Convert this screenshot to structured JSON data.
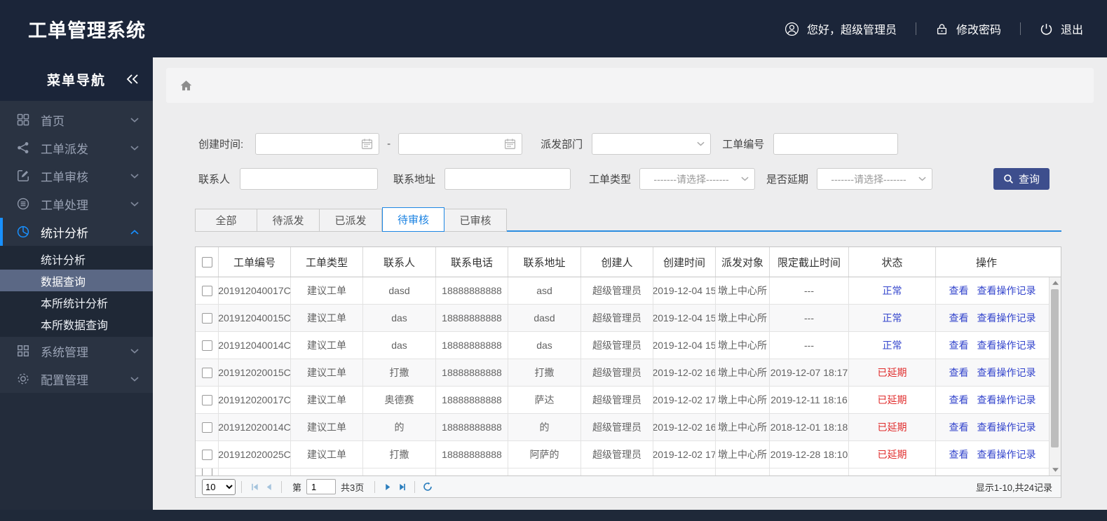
{
  "palette": {
    "accent_blue": "#1890ff",
    "link_blue": "#3344cc",
    "danger_red": "#e02b2b",
    "button_bg": "#3d4e8d",
    "header_bg": "#1b2539",
    "sidebar_bg": "#232c3b",
    "menu_bg": "#2a3342",
    "submenu_bg": "#1f2836",
    "submenu_active_bg": "#5b6885"
  },
  "header": {
    "title": "工单管理系统",
    "greeting": "您好，超级管理员",
    "change_password": "修改密码",
    "logout": "退出"
  },
  "sidebar": {
    "title": "菜单导航",
    "items": [
      {
        "id": "home",
        "label": "首页",
        "icon": "grid-icon"
      },
      {
        "id": "dispatch",
        "label": "工单派发",
        "icon": "share-icon"
      },
      {
        "id": "review",
        "label": "工单审核",
        "icon": "edit-icon"
      },
      {
        "id": "process",
        "label": "工单处理",
        "icon": "process-icon"
      },
      {
        "id": "stats",
        "label": "统计分析",
        "icon": "pie-icon",
        "active": true,
        "children": [
          {
            "id": "stats-analysis",
            "label": "统计分析"
          },
          {
            "id": "data-query",
            "label": "数据查询",
            "active": true
          },
          {
            "id": "branch-stats",
            "label": "本所统计分析"
          },
          {
            "id": "branch-data-query",
            "label": "本所数据查询"
          }
        ]
      },
      {
        "id": "system",
        "label": "系统管理",
        "icon": "modules-icon"
      },
      {
        "id": "config",
        "label": "配置管理",
        "icon": "gear-icon"
      }
    ]
  },
  "filters": {
    "create_time_label": "创建时间:",
    "range_separator": "-",
    "dispatch_dept_label": "派发部门",
    "order_no_label": "工单编号",
    "contact_label": "联系人",
    "address_label": "联系地址",
    "order_type_label": "工单类型",
    "delay_label": "是否延期",
    "select_placeholder": "-------请选择-------",
    "search_button": "查询"
  },
  "tabs": [
    {
      "id": "all",
      "label": "全部"
    },
    {
      "id": "pending-dispatch",
      "label": "待派发"
    },
    {
      "id": "dispatched",
      "label": "已派发"
    },
    {
      "id": "pending-review",
      "label": "待审核",
      "active": true
    },
    {
      "id": "reviewed",
      "label": "已审核"
    }
  ],
  "table": {
    "columns": [
      "工单编号",
      "工单类型",
      "联系人",
      "联系电话",
      "联系地址",
      "创建人",
      "创建时间",
      "派发对象",
      "限定截止时间",
      "状态",
      "操作"
    ],
    "action_labels": [
      "查看",
      "查看操作记录"
    ],
    "rows": [
      {
        "order_no": "201912040017C",
        "order_type": "建议工单",
        "contact": "dasd",
        "phone": "18888888888",
        "address": "asd",
        "creator": "超级管理员",
        "created_time": "2019-12-04 15",
        "dispatch_target": "墩上中心所",
        "deadline": "---",
        "status": "正常",
        "status_type": "normal"
      },
      {
        "order_no": "201912040015C",
        "order_type": "建议工单",
        "contact": "das",
        "phone": "18888888888",
        "address": "dasd",
        "creator": "超级管理员",
        "created_time": "2019-12-04 15",
        "dispatch_target": "墩上中心所",
        "deadline": "---",
        "status": "正常",
        "status_type": "normal"
      },
      {
        "order_no": "201912040014C",
        "order_type": "建议工单",
        "contact": "das",
        "phone": "18888888888",
        "address": "das",
        "creator": "超级管理员",
        "created_time": "2019-12-04 15",
        "dispatch_target": "墩上中心所",
        "deadline": "---",
        "status": "正常",
        "status_type": "normal"
      },
      {
        "order_no": "201912020015C",
        "order_type": "建议工单",
        "contact": "打撒",
        "phone": "18888888888",
        "address": "打撒",
        "creator": "超级管理员",
        "created_time": "2019-12-02 16",
        "dispatch_target": "墩上中心所",
        "deadline": "2019-12-07 18:17",
        "status": "已延期",
        "status_type": "delayed"
      },
      {
        "order_no": "201912020017C",
        "order_type": "建议工单",
        "contact": "奥德赛",
        "phone": "18888888888",
        "address": "萨达",
        "creator": "超级管理员",
        "created_time": "2019-12-02 17",
        "dispatch_target": "墩上中心所",
        "deadline": "2019-12-11 18:16",
        "status": "已延期",
        "status_type": "delayed"
      },
      {
        "order_no": "201912020014C",
        "order_type": "建议工单",
        "contact": "的",
        "phone": "18888888888",
        "address": "的",
        "creator": "超级管理员",
        "created_time": "2019-12-02 16",
        "dispatch_target": "墩上中心所",
        "deadline": "2018-12-01 18:18",
        "status": "已延期",
        "status_type": "delayed"
      },
      {
        "order_no": "201912020025C",
        "order_type": "建议工单",
        "contact": "打撒",
        "phone": "18888888888",
        "address": "阿萨的",
        "creator": "超级管理员",
        "created_time": "2019-12-02 17",
        "dispatch_target": "墩上中心所",
        "deadline": "2019-12-28 18:10",
        "status": "已延期",
        "status_type": "delayed"
      }
    ]
  },
  "pagination": {
    "page_size": "10",
    "page_prefix": "第",
    "current_page": "1",
    "total_pages": "共3页",
    "records_summary": "显示1-10,共24记录"
  }
}
